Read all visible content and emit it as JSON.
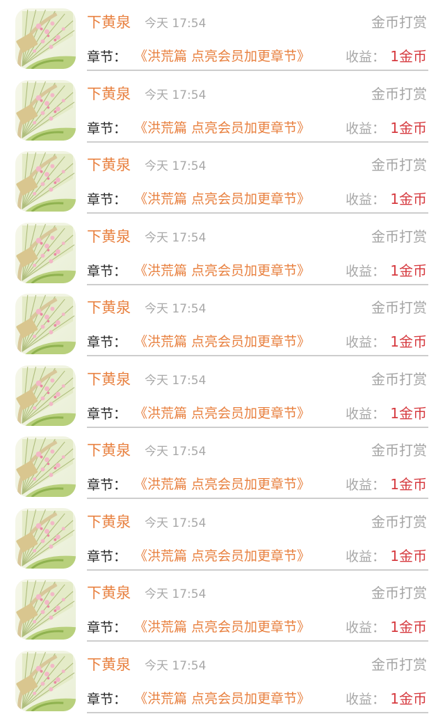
{
  "colors": {
    "name": "#e8803f",
    "chapter_title": "#e8803f",
    "income_value": "#d63a3f",
    "muted": "#a8a8a8",
    "divider": "#cdcdcd"
  },
  "avatar_icon": "folding-fan-image",
  "records": [
    {
      "name": "下黄泉",
      "time": "今天 17:54",
      "tag": "金币打赏",
      "chapter_label": "章节：",
      "chapter_title": "《洪荒篇 点亮会员加更章节》",
      "income_label": "收益：",
      "income_value": "1金币"
    },
    {
      "name": "下黄泉",
      "time": "今天 17:54",
      "tag": "金币打赏",
      "chapter_label": "章节：",
      "chapter_title": "《洪荒篇 点亮会员加更章节》",
      "income_label": "收益：",
      "income_value": "1金币"
    },
    {
      "name": "下黄泉",
      "time": "今天 17:54",
      "tag": "金币打赏",
      "chapter_label": "章节：",
      "chapter_title": "《洪荒篇 点亮会员加更章节》",
      "income_label": "收益：",
      "income_value": "1金币"
    },
    {
      "name": "下黄泉",
      "time": "今天 17:54",
      "tag": "金币打赏",
      "chapter_label": "章节：",
      "chapter_title": "《洪荒篇 点亮会员加更章节》",
      "income_label": "收益：",
      "income_value": "1金币"
    },
    {
      "name": "下黄泉",
      "time": "今天 17:54",
      "tag": "金币打赏",
      "chapter_label": "章节：",
      "chapter_title": "《洪荒篇 点亮会员加更章节》",
      "income_label": "收益：",
      "income_value": "1金币"
    },
    {
      "name": "下黄泉",
      "time": "今天 17:54",
      "tag": "金币打赏",
      "chapter_label": "章节：",
      "chapter_title": "《洪荒篇 点亮会员加更章节》",
      "income_label": "收益：",
      "income_value": "1金币"
    },
    {
      "name": "下黄泉",
      "time": "今天 17:54",
      "tag": "金币打赏",
      "chapter_label": "章节：",
      "chapter_title": "《洪荒篇 点亮会员加更章节》",
      "income_label": "收益：",
      "income_value": "1金币"
    },
    {
      "name": "下黄泉",
      "time": "今天 17:54",
      "tag": "金币打赏",
      "chapter_label": "章节：",
      "chapter_title": "《洪荒篇 点亮会员加更章节》",
      "income_label": "收益：",
      "income_value": "1金币"
    },
    {
      "name": "下黄泉",
      "time": "今天 17:54",
      "tag": "金币打赏",
      "chapter_label": "章节：",
      "chapter_title": "《洪荒篇 点亮会员加更章节》",
      "income_label": "收益：",
      "income_value": "1金币"
    },
    {
      "name": "下黄泉",
      "time": "今天 17:54",
      "tag": "金币打赏",
      "chapter_label": "章节：",
      "chapter_title": "《洪荒篇 点亮会员加更章节》",
      "income_label": "收益：",
      "income_value": "1金币"
    }
  ]
}
